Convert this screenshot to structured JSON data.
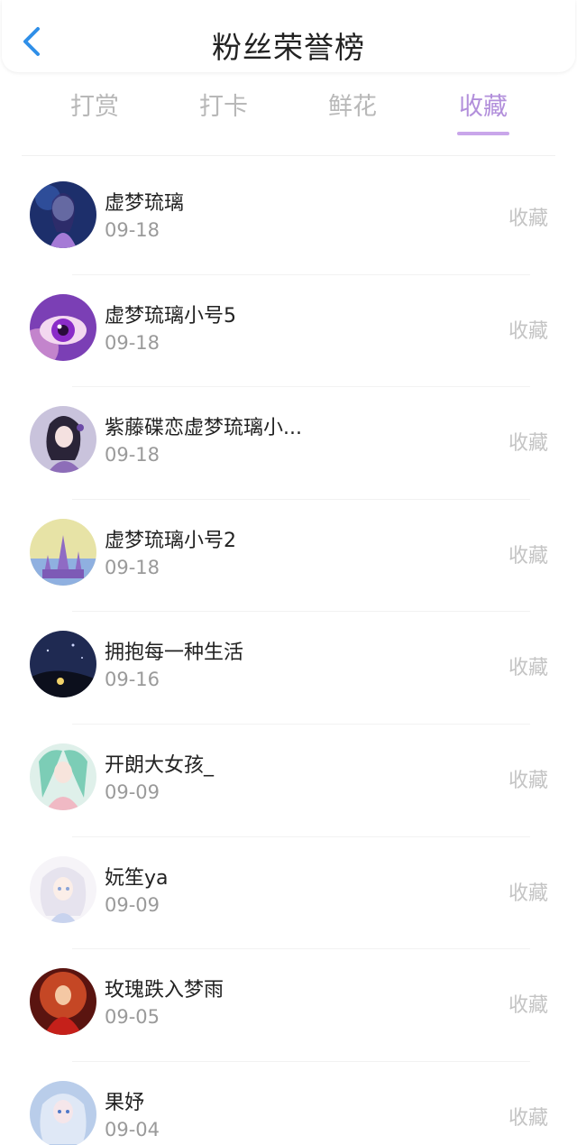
{
  "header": {
    "title": "粉丝荣誉榜",
    "back_icon": "chevron-left-icon",
    "accent": "#2f8fe8"
  },
  "tabs": [
    {
      "label": "打赏"
    },
    {
      "label": "打卡"
    },
    {
      "label": "鲜花"
    },
    {
      "label": "收藏",
      "active": true
    }
  ],
  "colors": {
    "active_tab": "#b28fdb",
    "underline": "#c9a6ea"
  },
  "fans": [
    {
      "name": "虚梦琉璃",
      "date": "09-18",
      "action": "收藏",
      "avatar": "avatar-blue-girl"
    },
    {
      "name": "虚梦琉璃小号5",
      "date": "09-18",
      "action": "收藏",
      "avatar": "avatar-purple-eye"
    },
    {
      "name": "紫藤碟恋虚梦琉璃小...",
      "date": "09-18",
      "action": "收藏",
      "avatar": "avatar-girl-lilac"
    },
    {
      "name": "虚梦琉璃小号2",
      "date": "09-18",
      "action": "收藏",
      "avatar": "avatar-castle"
    },
    {
      "name": "拥抱每一种生活",
      "date": "09-16",
      "action": "收藏",
      "avatar": "avatar-night-sky"
    },
    {
      "name": "开朗大女孩_",
      "date": "09-09",
      "action": "收藏",
      "avatar": "avatar-teal-girl"
    },
    {
      "name": "妧笙ya",
      "date": "09-09",
      "action": "收藏",
      "avatar": "avatar-white-girl"
    },
    {
      "name": "玫瑰跌入梦雨",
      "date": "09-05",
      "action": "收藏",
      "avatar": "avatar-red-girl"
    },
    {
      "name": "果妤",
      "date": "09-04",
      "action": "收藏",
      "avatar": "avatar-blue-anime"
    }
  ]
}
